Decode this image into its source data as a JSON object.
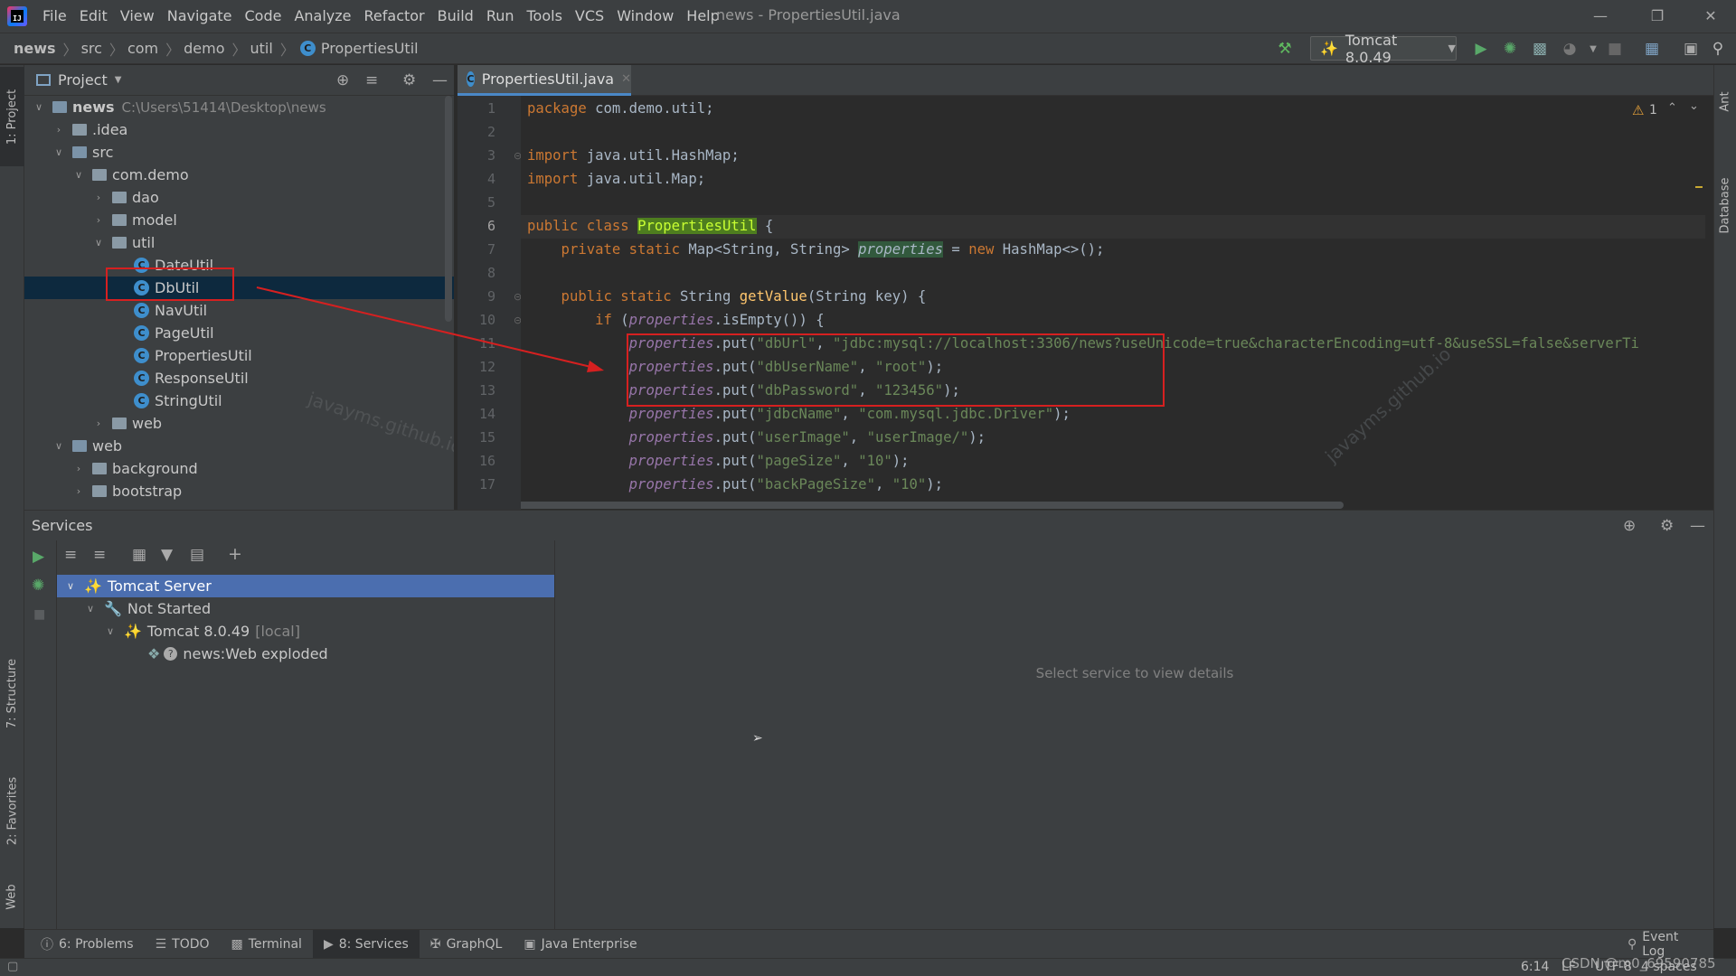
{
  "titlebar": {
    "menu": [
      "File",
      "Edit",
      "View",
      "Navigate",
      "Code",
      "Analyze",
      "Refactor",
      "Build",
      "Run",
      "Tools",
      "VCS",
      "Window",
      "Help"
    ],
    "window_title": "news - PropertiesUtil.java"
  },
  "breadcrumb": [
    "news",
    "src",
    "com",
    "demo",
    "util",
    "PropertiesUtil"
  ],
  "run_config": "Tomcat 8.0.49",
  "project": {
    "title": "Project",
    "root_name": "news",
    "root_path": "C:\\Users\\51414\\Desktop\\news",
    "items": [
      ".idea",
      "src",
      "com.demo",
      "dao",
      "model",
      "util",
      "DateUtil",
      "DbUtil",
      "NavUtil",
      "PageUtil",
      "PropertiesUtil",
      "ResponseUtil",
      "StringUtil",
      "web",
      "web",
      "background",
      "bootstrap"
    ]
  },
  "editor": {
    "tab": "PropertiesUtil.java",
    "warnings": "1",
    "lines": [
      "1",
      "2",
      "3",
      "4",
      "5",
      "6",
      "7",
      "8",
      "9",
      "10",
      "11",
      "12",
      "13",
      "14",
      "15",
      "16",
      "17"
    ],
    "code": {
      "l1a": "package ",
      "l1b": "com.demo.util;",
      "l3a": "import ",
      "l3b": "java.util.HashMap;",
      "l4a": "import ",
      "l4b": "java.util.Map;",
      "l6a": "public class ",
      "l6b": "PropertiesUtil",
      " l6c": " {",
      "l7a": "    private static ",
      "l7b": "Map<String, String> ",
      "l7c": "properties",
      "l7d": " = ",
      "l7e": "new ",
      "l7f": "HashMap<>();",
      "l9a": "    public static ",
      "l9b": "String ",
      "l9c": "getValue",
      "l9d": "(String key) {",
      "l10a": "        if ",
      "l10b": "(",
      "l10c": "properties",
      ".isEmpty": "",
      "l10d": ".isEmpty()) {",
      "props": [
        {
          "key": "\"dbUrl\"",
          "val": "\"jdbc:mysql://localhost:3306/news?useUnicode=true&characterEncoding=utf-8&useSSL=false&serverTi"
        },
        {
          "key": "\"dbUserName\"",
          "val": "\"root\""
        },
        {
          "key": "\"dbPassword\"",
          "val": "\"123456\""
        },
        {
          "key": "\"jdbcName\"",
          "val": "\"com.mysql.jdbc.Driver\""
        },
        {
          "key": "\"userImage\"",
          "val": "\"userImage/\""
        },
        {
          "key": "\"pageSize\"",
          "val": "\"10\""
        },
        {
          "key": "\"backPageSize\"",
          "val": "\"10\""
        }
      ],
      "prop_name": "properties",
      "put": ".put(",
      "comma": ", ",
      "close": ");"
    }
  },
  "services": {
    "title": "Services",
    "tree": [
      "Tomcat Server",
      "Not Started",
      "Tomcat 8.0.49",
      "[local]",
      "news:Web exploded"
    ],
    "empty_text": "Select service to view details"
  },
  "bottom_tabs": [
    "6: Problems",
    "TODO",
    "Terminal",
    "8: Services",
    "GraphQL",
    "Java Enterprise"
  ],
  "event_log": "Event Log",
  "status": {
    "pos": "6:14",
    "lf": "LF",
    "enc": "UTF-8",
    "indent": "4 spaces"
  },
  "left_strip": [
    "1: Project",
    "7: Structure",
    "2: Favorites",
    "Web"
  ],
  "right_strip": [
    "Ant",
    "Database"
  ],
  "watermarks": [
    "javayms.github.io",
    "javayms.github.io",
    "CSDN @m0_69590785"
  ],
  "colors": {
    "keyword": "#cc7832",
    "string": "#6a8759",
    "field": "#9876aa",
    "function": "#ffc66d",
    "selection": "#0d293e",
    "annotation_red": "#d62020"
  }
}
